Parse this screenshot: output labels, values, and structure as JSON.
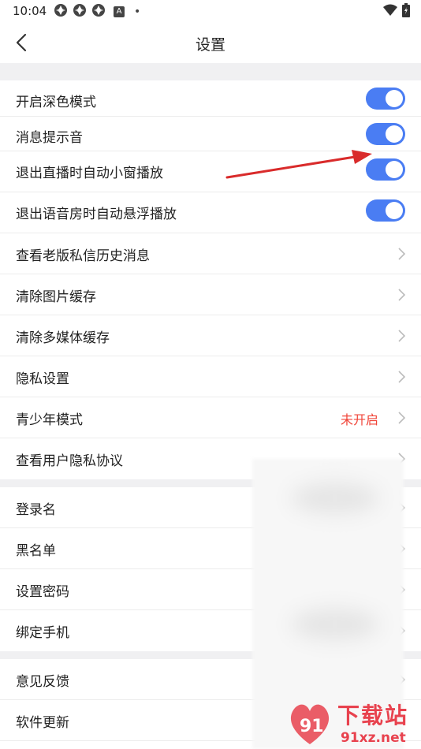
{
  "status_bar": {
    "time": "10:04",
    "indicator_letter": "A",
    "dot": "•"
  },
  "header": {
    "title": "设置"
  },
  "rows": [
    {
      "label": "开启深色模式",
      "type": "toggle"
    },
    {
      "label": "消息提示音",
      "type": "toggle"
    },
    {
      "label": "退出直播时自动小窗播放",
      "type": "toggle"
    },
    {
      "label": "退出语音房时自动悬浮播放",
      "type": "toggle"
    },
    {
      "label": "查看老版私信历史消息",
      "type": "nav"
    },
    {
      "label": "清除图片缓存",
      "type": "nav"
    },
    {
      "label": "清除多媒体缓存",
      "type": "nav"
    },
    {
      "label": "隐私设置",
      "type": "nav"
    },
    {
      "label": "青少年模式",
      "type": "nav",
      "value": "未开启"
    },
    {
      "label": "查看用户隐私协议",
      "type": "nav"
    },
    {
      "label": "登录名",
      "type": "nav"
    },
    {
      "label": "黑名单",
      "type": "nav"
    },
    {
      "label": "设置密码",
      "type": "nav"
    },
    {
      "label": "绑定手机",
      "type": "nav"
    },
    {
      "label": "意见反馈",
      "type": "nav"
    },
    {
      "label": "软件更新",
      "type": "nav"
    }
  ],
  "watermark": {
    "brand": "下载站",
    "site": "91xz.net"
  },
  "colors": {
    "toggle_on": "#4a7df3",
    "accent_red": "#f04438",
    "arrow": "#d92b2b",
    "section_gap": "#f0f0f2"
  }
}
